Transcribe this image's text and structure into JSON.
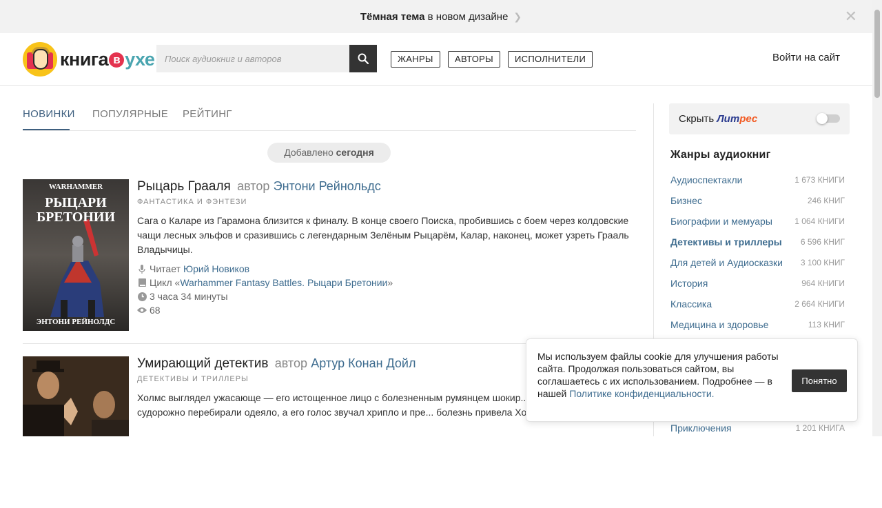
{
  "promo": {
    "bold": "Тёмная тема",
    "text": " в новом дизайне",
    "chevron": "❯",
    "close": "✕"
  },
  "header": {
    "logo": {
      "part1": "книга",
      "part2": "в",
      "part3": "ухе"
    },
    "search_placeholder": "Поиск аудиокниг и авторов",
    "nav": [
      "ЖАНРЫ",
      "АВТОРЫ",
      "ИСПОЛНИТЕЛИ"
    ],
    "login": "Войти на сайт"
  },
  "tabs": [
    "НОВИНКИ",
    "ПОПУЛЯРНЫЕ",
    "РЕЙТИНГ"
  ],
  "date_label": {
    "prefix": "Добавлено ",
    "day": "сегодня"
  },
  "books": [
    {
      "title": "Рыцарь Грааля",
      "by": "автор",
      "author": "Энтони Рейнольдс",
      "genre": "ФАНТАСТИКА И ФЭНТЕЗИ",
      "description": "Сага о Каларе из Гарамона близится к финалу. В конце своего Поиска, пробившись с боем через колдовские чащи лесных эльфов и сразившись с легендарным Зелёным Рыцарём, Калар, наконец, может узреть Грааль Владычицы.",
      "reader_label": "Читает",
      "reader": "Юрий Новиков",
      "cycle_label": "Цикл «",
      "cycle": "Warhammer Fantasy Battles. Рыцари Бретонии",
      "cycle_end": "»",
      "duration": "3 часа 34 минуты",
      "views": "68",
      "cover": {
        "top": "WARHAMMER",
        "line1": "РЫЦАРИ",
        "line2": "БРЕТОНИИ",
        "bottom": "ЭНТОНИ РЕЙНОЛДС"
      }
    },
    {
      "title": "Умирающий детектив",
      "by": "автор",
      "author": "Артур Конан Дойл",
      "genre": "ДЕТЕКТИВЫ И ТРИЛЛЕРЫ",
      "description": "Холмс выглядел ужасающе — его истощенное лицо с болезненным румянцем шокир... Худые руки детектива судорожно перебирали одеяло, а его голос звучал хрипло и пре... болезнь привела Холмса на край гибели?"
    }
  ],
  "sidebar": {
    "litres_hide": "Скрыть ",
    "litres_brand_a": "Лит",
    "litres_brand_b": "рес",
    "genres_title": "Жанры аудиокниг",
    "genres": [
      {
        "name": "Аудиоспектакли",
        "count": "1 673 КНИГИ"
      },
      {
        "name": "Бизнес",
        "count": "246 КНИГ"
      },
      {
        "name": "Биографии и мемуары",
        "count": "1 064 КНИГИ"
      },
      {
        "name": "Детективы и триллеры",
        "count": "6 596 КНИГ"
      },
      {
        "name": "Для детей и Аудиосказки",
        "count": "3 100 КНИГ"
      },
      {
        "name": "История",
        "count": "964 КНИГИ"
      },
      {
        "name": "Классика",
        "count": "2 664 КНИГИ"
      },
      {
        "name": "Медицина и здоровье",
        "count": "113 КНИГ"
      }
    ],
    "last_genre": {
      "name": "Приключения",
      "count": "1 201 КНИГА"
    }
  },
  "cookie": {
    "text": "Мы используем файлы cookie для улучшения работы сайта. Продолжая пользоваться сайтом, вы соглашаетесь с их использованием. Подробнее — в нашей ",
    "link": "Политике конфиденциальности.",
    "button": "Понятно"
  },
  "colors": {
    "accent": "#3e6c8f",
    "dark": "#333333",
    "logo_red": "#e4334f",
    "logo_teal": "#4aa5b0"
  }
}
